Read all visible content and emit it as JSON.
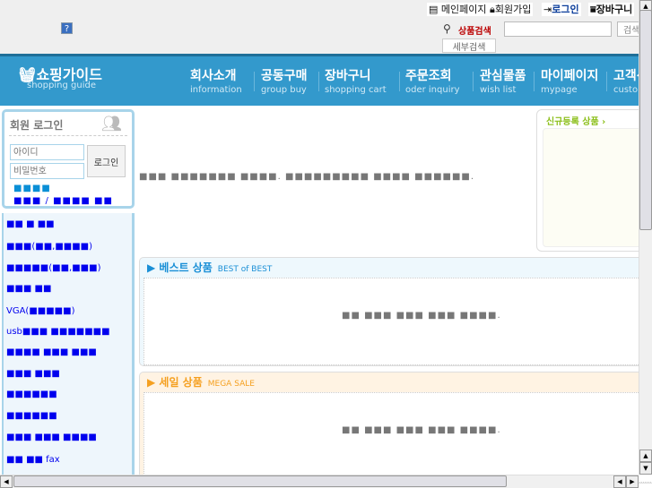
{
  "top_links": [
    {
      "icon": "document-icon",
      "label": "메인페이지"
    },
    {
      "icon": "lock-icon",
      "label": "회원가입"
    },
    {
      "icon": "login-arrow-icon",
      "label": "로그인"
    },
    {
      "icon": "cart-icon",
      "label": "장바구니"
    }
  ],
  "search": {
    "label": "상품검색",
    "value": "",
    "button": "검색",
    "detail_button": "세부검색"
  },
  "help": "?",
  "logo": {
    "title": "쇼핑가이드",
    "subtitle": "shopping guide"
  },
  "nav": [
    {
      "k": "회사소개",
      "e": "information"
    },
    {
      "k": "공동구매",
      "e": "group buy"
    },
    {
      "k": "장바구니",
      "e": "shopping cart"
    },
    {
      "k": "주문조회",
      "e": "oder inquiry"
    },
    {
      "k": "관심물품",
      "e": "wish list"
    },
    {
      "k": "마이페이지",
      "e": "mypage"
    },
    {
      "k": "고객센터",
      "e": "customer"
    }
  ],
  "login": {
    "title": "회원 로그인",
    "id_placeholder": "아이디",
    "pw_placeholder": "비밀번호",
    "button": "로그인",
    "link1": "■■■■",
    "link2": "■■■ / ■■■■ ■■"
  },
  "categories": [
    "■■ ■ ■■",
    "■■■(■■,■■■■)",
    "■■■■■(■■,■■■)",
    "■■■ ■■",
    "VGA(■■■■■)",
    "usb■■■ ■■■■■■■",
    "■■■■ ■■■ ■■■",
    "■■■ ■■■",
    "■■■■■■",
    "■■■■■■",
    "■■■ ■■■ ■■■■",
    "■■ ■■ fax"
  ],
  "main_notice": "■■■ ■■■■■■■ ■■■■. ■■■■■■■■■ ■■■■ ■■■■■■.",
  "new_products": {
    "title": "신규등록 상품 ›"
  },
  "best": {
    "title": "베스트 상품",
    "subtitle": "BEST of BEST",
    "empty": "■■ ■■■ ■■■ ■■■ ■■■■."
  },
  "sale": {
    "title": "세일 상품",
    "subtitle": "MEGA SALE",
    "empty": "■■ ■■■ ■■■ ■■■ ■■■■."
  },
  "colors": {
    "nav": "#3399cc",
    "best": "#1a8fd6",
    "sale": "#f5a020",
    "new": "#8cbf1a"
  }
}
